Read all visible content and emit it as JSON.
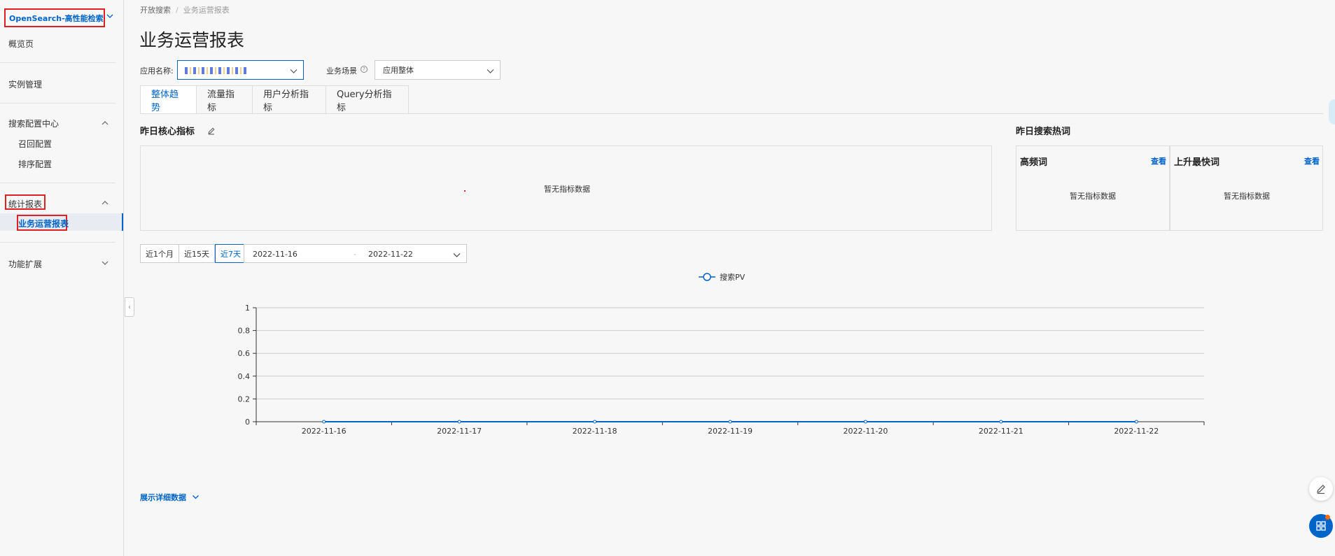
{
  "sidebar": {
    "product": "OpenSearch-高性能检索版",
    "items": [
      {
        "label": "概览页"
      },
      {
        "label": "实例管理"
      },
      {
        "label": "搜索配置中心"
      },
      {
        "label": "召回配置"
      },
      {
        "label": "排序配置"
      },
      {
        "label": "统计报表"
      },
      {
        "label": "业务运营报表"
      },
      {
        "label": "功能扩展"
      }
    ]
  },
  "breadcrumb": {
    "root": "开放搜索",
    "separator": "/",
    "current": "业务运营报表"
  },
  "page_title": "业务运营报表",
  "filters": {
    "app_label": "应用名称:",
    "scene_label": "业务场景",
    "scene_value": "应用整体"
  },
  "tabs": [
    {
      "label": "整体趋势",
      "active": true
    },
    {
      "label": "流量指标"
    },
    {
      "label": "用户分析指标"
    },
    {
      "label": "Query分析指标"
    }
  ],
  "core_metrics": {
    "title": "昨日核心指标",
    "empty": "暂无指标数据"
  },
  "hot_words": {
    "title": "昨日搜索热词",
    "high_freq": {
      "title": "高频词",
      "link": "查看",
      "empty": "暂无指标数据"
    },
    "rising": {
      "title": "上升最快词",
      "link": "查看",
      "empty": "暂无指标数据"
    }
  },
  "date_range": {
    "quick": [
      "近1个月",
      "近15天",
      "近7天"
    ],
    "active": "近7天",
    "start": "2022-11-16",
    "separator": "-",
    "end": "2022-11-22"
  },
  "chart_data": {
    "type": "line",
    "legend": [
      "搜索PV"
    ],
    "legend_position": "top-center",
    "x": [
      "2022-11-16",
      "2022-11-17",
      "2022-11-18",
      "2022-11-19",
      "2022-11-20",
      "2022-11-21",
      "2022-11-22"
    ],
    "series": [
      {
        "name": "搜索PV",
        "values": [
          0,
          0,
          0,
          0,
          0,
          0,
          0
        ]
      }
    ],
    "ylim": [
      0,
      1
    ],
    "yticks": [
      "0",
      "0.2",
      "0.4",
      "0.6",
      "0.8",
      "1"
    ],
    "grid": true,
    "color": "#0064c8"
  },
  "expand_link": "展示详细数据",
  "colors": {
    "accent": "#0064c8",
    "highlight": "#e02020"
  }
}
